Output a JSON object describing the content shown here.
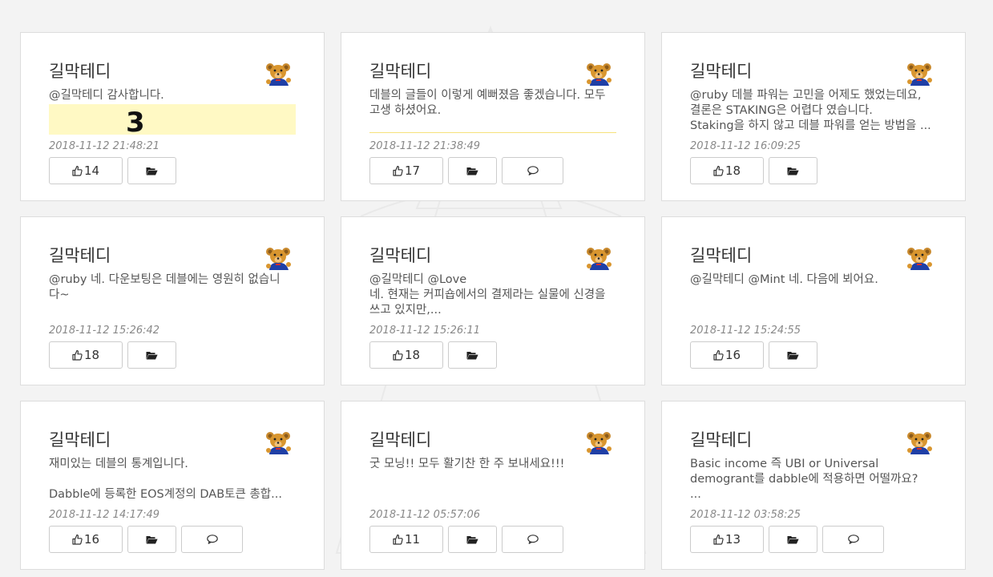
{
  "colors": {
    "page_background": "#f3f3f3",
    "card_background": "#ffffff",
    "card_border": "#dddddd",
    "author_text": "#333333",
    "content_text": "#555555",
    "timestamp_text": "#888888",
    "thumbnail_yellow": "#fff9c4",
    "button_border": "#cccccc"
  },
  "icons": {
    "avatar": "teddy-bear-icon",
    "like": "thumbs-up-icon",
    "folder": "folder-open-icon",
    "comment": "comment-icon"
  },
  "cards": [
    {
      "author": "길막테디",
      "lines": [
        "@길막테디 감사합니다."
      ],
      "thumbnail": "yellow",
      "thumbnail_mark": "3",
      "timestamp": "2018-11-12 21:48:21",
      "likes": "14",
      "has_comment": false
    },
    {
      "author": "길막테디",
      "lines": [
        "데블의 글들이 이렇게 예뻐졌음 좋겠습니다. 모두",
        "고생 하셨어요."
      ],
      "thumbnail": "line",
      "timestamp": "2018-11-12 21:38:49",
      "likes": "17",
      "has_comment": true
    },
    {
      "author": "길막테디",
      "lines": [
        "@ruby 데블 파워는 고민을 어제도 했었는데요,",
        "결론은 STAKING은 어렵다 였습니다.",
        "Staking을 하지 않고 데블 파워를 얻는 방법을 ..."
      ],
      "thumbnail": "none",
      "timestamp": "2018-11-12 16:09:25",
      "likes": "18",
      "has_comment": false
    },
    {
      "author": "길막테디",
      "lines": [
        "@ruby 네. 다운보팅은 데블에는 영원히 없습니",
        "다~"
      ],
      "thumbnail": "none",
      "timestamp": "2018-11-12 15:26:42",
      "likes": "18",
      "has_comment": false
    },
    {
      "author": "길막테디",
      "lines": [
        "@길막테디 @Love",
        "네. 현재는 커피숍에서의 결제라는 실물에 신경을",
        "쓰고 있지만,..."
      ],
      "thumbnail": "none",
      "timestamp": "2018-11-12 15:26:11",
      "likes": "18",
      "has_comment": false
    },
    {
      "author": "길막테디",
      "lines": [
        "@길막테디 @Mint 네. 다음에 뵈어요."
      ],
      "thumbnail": "none",
      "timestamp": "2018-11-12 15:24:55",
      "likes": "16",
      "has_comment": false
    },
    {
      "author": "길막테디",
      "lines": [
        "재미있는 데블의 통계입니다.",
        "",
        "Dabble에 등록한 EOS계정의 DAB토큰 총합..."
      ],
      "thumbnail": "none",
      "timestamp": "2018-11-12 14:17:49",
      "likes": "16",
      "has_comment": true
    },
    {
      "author": "길막테디",
      "lines": [
        "굿 모닝!! 모두 활기찬 한 주 보내세요!!!"
      ],
      "thumbnail": "none",
      "timestamp": "2018-11-12 05:57:06",
      "likes": "11",
      "has_comment": true
    },
    {
      "author": "길막테디",
      "lines": [
        "Basic income 즉 UBI or Universal",
        "demogrant를 dabble에 적용하면 어떨까요?",
        "..."
      ],
      "thumbnail": "none",
      "timestamp": "2018-11-12 03:58:25",
      "likes": "13",
      "has_comment": true
    }
  ]
}
